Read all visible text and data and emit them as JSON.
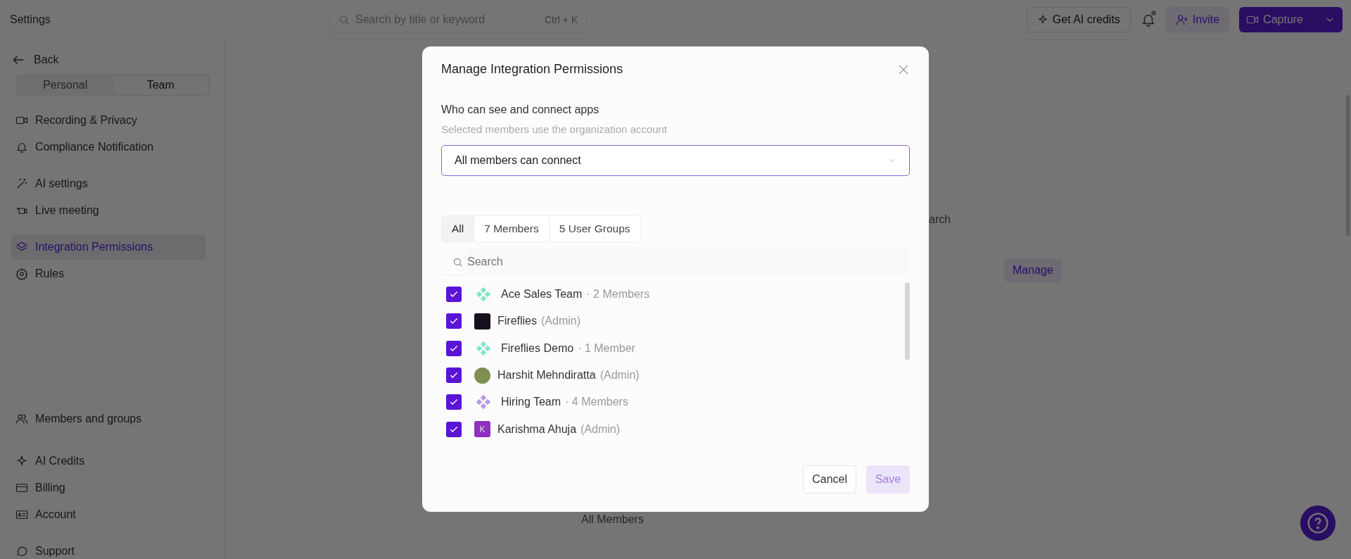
{
  "top_bar": {
    "title": "Settings",
    "search": {
      "placeholder": "Search by title or keyword",
      "shortcut": "Ctrl + K"
    },
    "credits_button": "Get AI credits",
    "invite_button": "Invite",
    "capture_button": "Capture"
  },
  "sidebar": {
    "back": "Back",
    "scope_tabs": [
      {
        "label": "Personal",
        "selected": false
      },
      {
        "label": "Team",
        "selected": true
      }
    ],
    "groups": [
      [
        {
          "label": "Recording & Privacy",
          "selected": false
        },
        {
          "label": "Compliance Notification",
          "selected": false
        }
      ],
      [
        {
          "label": "AI settings",
          "selected": false
        },
        {
          "label": "Live meeting",
          "selected": false
        }
      ],
      [
        {
          "label": "Integration Permissions",
          "selected": true
        },
        {
          "label": "Rules",
          "selected": false
        }
      ],
      [
        {
          "label": "Members and groups",
          "selected": false
        }
      ],
      [
        {
          "label": "AI Credits",
          "selected": false
        },
        {
          "label": "Billing",
          "selected": false
        },
        {
          "label": "Account",
          "selected": false
        }
      ],
      [
        {
          "label": "Support",
          "selected": false
        }
      ]
    ]
  },
  "background": {
    "search_text": "arch",
    "manage_button": "Manage",
    "members_text": "All Members"
  },
  "modal": {
    "title": "Manage Integration Permissions",
    "section_label": "Who can see and connect apps",
    "section_hint": "Selected members use the organization account",
    "select": {
      "value": "All members can connect"
    },
    "filter_tabs": [
      {
        "label": "All",
        "selected": true
      },
      {
        "label": "7 Members",
        "selected": false
      },
      {
        "label": "5 User Groups",
        "selected": false
      }
    ],
    "search": {
      "placeholder": "Search"
    },
    "rows": [
      {
        "kind": "group",
        "name": "Ace Sales Team",
        "detail": "· 2 Members",
        "checked": true,
        "color": "#7de8c8"
      },
      {
        "kind": "logo",
        "name": "Fireflies",
        "detail": "(Admin)",
        "checked": true,
        "color": "#15101c"
      },
      {
        "kind": "group",
        "name": "Fireflies Demo",
        "detail": "· 1 Member",
        "checked": true,
        "color": "#7de8c8"
      },
      {
        "kind": "photo",
        "name": "Harshit Mehndiratta",
        "detail": "(Admin)",
        "checked": true,
        "color": "#7f8f52"
      },
      {
        "kind": "group",
        "name": "Hiring Team",
        "detail": "· 4 Members",
        "checked": true,
        "color": "#b89ae6"
      },
      {
        "kind": "initial",
        "name": "Karishma Ahuja",
        "detail": "(Admin)",
        "checked": true,
        "color": "#8e2fc0",
        "initial": "K"
      }
    ],
    "cancel_button": "Cancel",
    "save_button": {
      "label": "Save",
      "disabled": true
    }
  }
}
